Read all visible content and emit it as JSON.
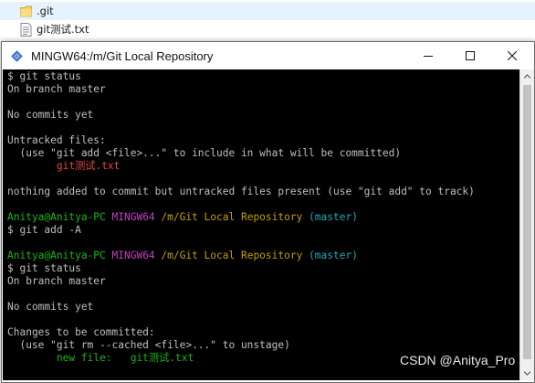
{
  "explorer": {
    "files": [
      {
        "name": ".git",
        "icon": "folder-icon",
        "selected": true
      },
      {
        "name": "git测试.txt",
        "icon": "text-file-icon",
        "selected": false
      },
      {
        "name": "",
        "icon": "",
        "selected": false
      }
    ]
  },
  "window": {
    "title": "MINGW64:/m/Git Local Repository",
    "app_icon": "git-bash-icon",
    "controls": [
      "minimize-icon",
      "maximize-icon",
      "close-icon"
    ]
  },
  "colors": {
    "terminal_bg": "#000000",
    "default_text": "#bfbfbf",
    "red": "#e04848",
    "green": "#17b817",
    "magenta": "#c040c0",
    "yellow": "#c0a000",
    "cyan": "#20a8b8"
  },
  "terminal": {
    "lines": [
      [
        {
          "text": "$ git status",
          "color": "#bfbfbf"
        }
      ],
      [
        {
          "text": "On branch master",
          "color": "#bfbfbf"
        }
      ],
      [
        {
          "text": "",
          "color": "#bfbfbf"
        }
      ],
      [
        {
          "text": "No commits yet",
          "color": "#bfbfbf"
        }
      ],
      [
        {
          "text": "",
          "color": "#bfbfbf"
        }
      ],
      [
        {
          "text": "Untracked files:",
          "color": "#bfbfbf"
        }
      ],
      [
        {
          "text": "  (use \"git add <file>...\" to include in what will be committed)",
          "color": "#bfbfbf"
        }
      ],
      [
        {
          "text": "        git测试.txt",
          "color": "#e04848"
        }
      ],
      [
        {
          "text": "",
          "color": "#bfbfbf"
        }
      ],
      [
        {
          "text": "nothing added to commit but untracked files present (use \"git add\" to track)",
          "color": "#bfbfbf"
        }
      ],
      [
        {
          "text": "",
          "color": "#bfbfbf"
        }
      ],
      [
        {
          "text": "Anitya@Anitya-PC ",
          "color": "#17b817"
        },
        {
          "text": "MINGW64 ",
          "color": "#c040c0"
        },
        {
          "text": "/m/Git Local Repository ",
          "color": "#c0a000"
        },
        {
          "text": "(master)",
          "color": "#20a8b8"
        }
      ],
      [
        {
          "text": "$ git add -A",
          "color": "#bfbfbf"
        }
      ],
      [
        {
          "text": "",
          "color": "#bfbfbf"
        }
      ],
      [
        {
          "text": "Anitya@Anitya-PC ",
          "color": "#17b817"
        },
        {
          "text": "MINGW64 ",
          "color": "#c040c0"
        },
        {
          "text": "/m/Git Local Repository ",
          "color": "#c0a000"
        },
        {
          "text": "(master)",
          "color": "#20a8b8"
        }
      ],
      [
        {
          "text": "$ git status",
          "color": "#bfbfbf"
        }
      ],
      [
        {
          "text": "On branch master",
          "color": "#bfbfbf"
        }
      ],
      [
        {
          "text": "",
          "color": "#bfbfbf"
        }
      ],
      [
        {
          "text": "No commits yet",
          "color": "#bfbfbf"
        }
      ],
      [
        {
          "text": "",
          "color": "#bfbfbf"
        }
      ],
      [
        {
          "text": "Changes to be committed:",
          "color": "#bfbfbf"
        }
      ],
      [
        {
          "text": "  (use \"git rm --cached <file>...\" to unstage)",
          "color": "#bfbfbf"
        }
      ],
      [
        {
          "text": "        new file:   git测试.txt",
          "color": "#17b817"
        }
      ]
    ]
  },
  "watermark": "CSDN @Anitya_Pro"
}
